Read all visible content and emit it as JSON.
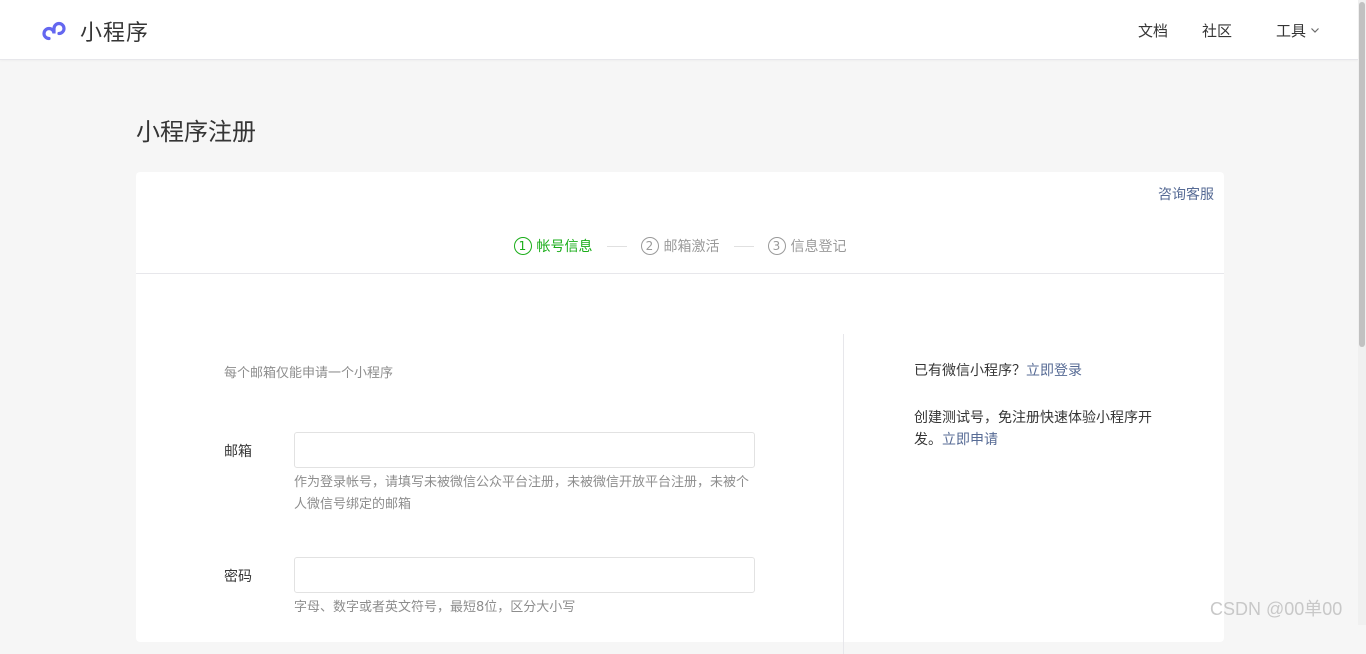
{
  "header": {
    "logo_text": "小程序",
    "nav": {
      "docs": "文档",
      "community": "社区",
      "tools": "工具"
    }
  },
  "page": {
    "title": "小程序注册"
  },
  "card": {
    "support_link": "咨询客服",
    "steps": [
      {
        "num": "1",
        "label": "帐号信息"
      },
      {
        "num": "2",
        "label": "邮箱激活"
      },
      {
        "num": "3",
        "label": "信息登记"
      }
    ],
    "form": {
      "hint": "每个邮箱仅能申请一个小程序",
      "email_label": "邮箱",
      "email_value": "",
      "email_tip": "作为登录帐号，请填写未被微信公众平台注册，未被微信开放平台注册，未被个人微信号绑定的邮箱",
      "password_label": "密码",
      "password_value": "",
      "password_tip": "字母、数字或者英文符号，最短8位，区分大小写"
    },
    "side": {
      "existing_text": "已有微信小程序？",
      "login_link": "立即登录",
      "test_text": "创建测试号，免注册快速体验小程序开发。",
      "apply_link": "立即申请"
    }
  },
  "watermark": "CSDN @00单00",
  "colors": {
    "active_step": "#1aad19",
    "link": "#576b95",
    "muted": "#8d8d8d"
  }
}
